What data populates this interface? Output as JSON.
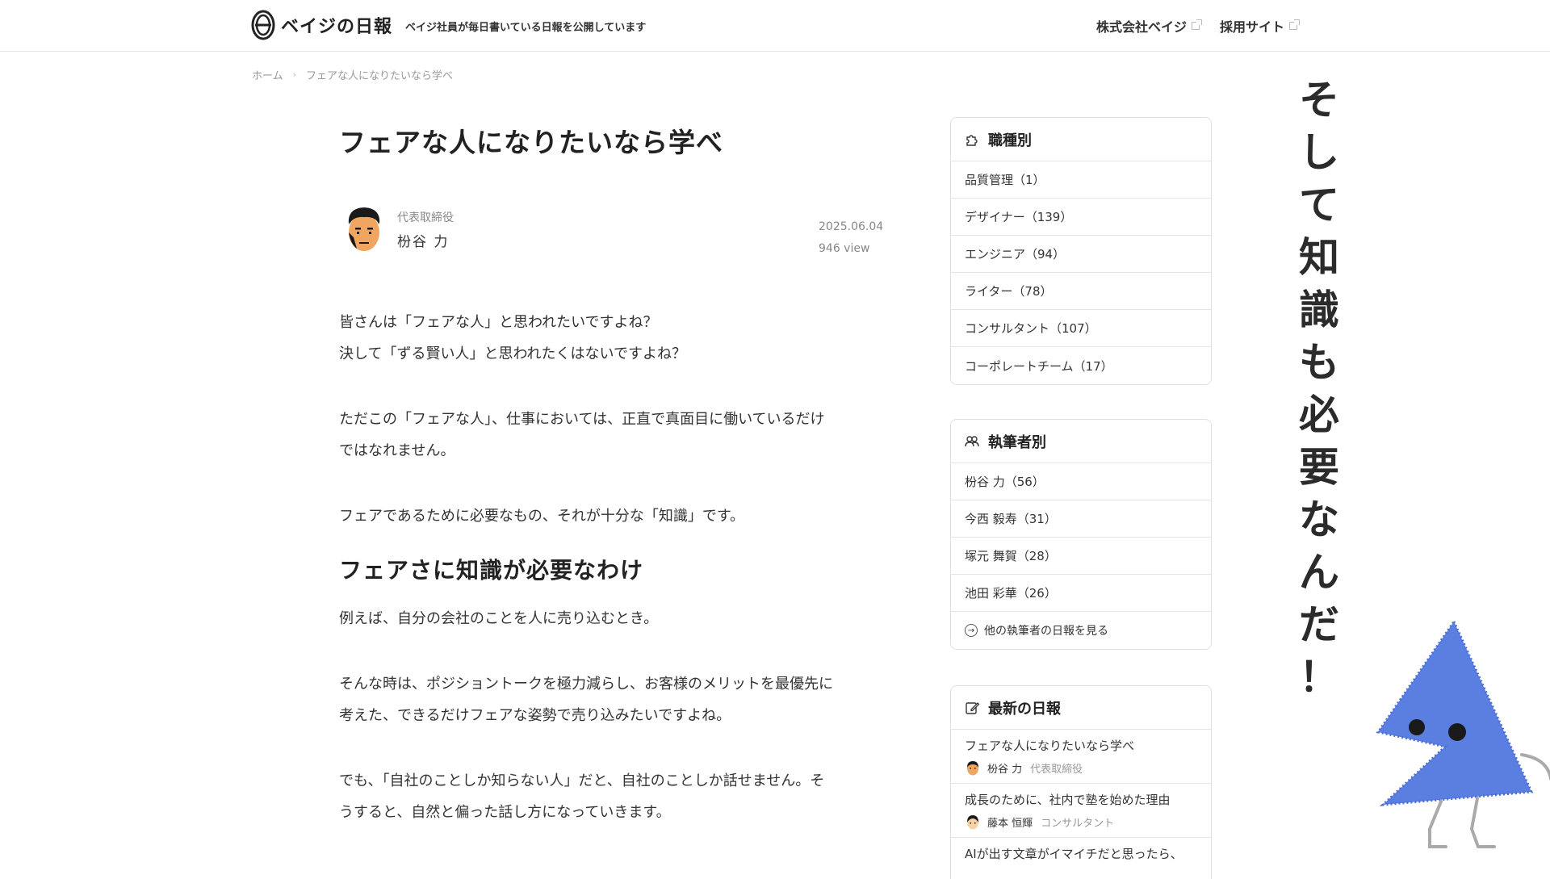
{
  "header": {
    "logo_text": "ベイジの日報",
    "tagline": "ベイジ社員が毎日書いている日報を公開しています",
    "links": [
      "株式会社ベイジ",
      "採用サイト"
    ]
  },
  "breadcrumb": {
    "home": "ホーム",
    "current": "フェアな人になりたいなら学べ"
  },
  "article": {
    "title": "フェアな人になりたいなら学べ",
    "author_role": "代表取締役",
    "author_name": "枌谷 力",
    "date": "2025.06.04",
    "views": "946 view",
    "p1_l1": "皆さんは「フェアな人」と思われたいですよね？",
    "p1_l2": "決して「ずる賢い人」と思われたくはないですよね？",
    "p2_l1": "ただこの「フェアな人」、仕事においては、正直で真面目に働いているだけ",
    "p2_l2": "ではなれません。",
    "p3": "フェアであるために必要なもの、それが十分な「知識」です。",
    "h2": "フェアさに知識が必要なわけ",
    "p4": "例えば、自分の会社のことを人に売り込むとき。",
    "p5_l1": "そんな時は、ポジショントークを極力減らし、お客様のメリットを最優先に",
    "p5_l2": "考えた、できるだけフェアな姿勢で売り込みたいですよね。",
    "p6_l1": "でも、「自社のことしか知らない人」だと、自社のことしか話せません。そ",
    "p6_l2": "うすると、自然と偏った話し方になっていきます。"
  },
  "sidebar": {
    "job": {
      "title": "職種別",
      "icon": "puzzle-icon",
      "items": [
        "品質管理（1）",
        "デザイナー（139）",
        "エンジニア（94）",
        "ライター（78）",
        "コンサルタント（107）",
        "コーポレートチーム（17）"
      ]
    },
    "writers": {
      "title": "執筆者別",
      "icon": "people-icon",
      "items": [
        "枌谷 力（56）",
        "今西 毅寿（31）",
        "塚元 舞賀（28）",
        "池田 彩華（26）"
      ],
      "more": "他の執筆者の日報を見る"
    },
    "latest": {
      "title": "最新の日報",
      "icon": "edit-icon",
      "items": [
        {
          "title": "フェアな人になりたいなら学べ",
          "name": "枌谷 力",
          "role": "代表取締役"
        },
        {
          "title": "成長のために、社内で塾を始めた理由",
          "name": "藤本 恒輝",
          "role": "コンサルタント"
        },
        {
          "title": "AIが出す文章がイマイチだと思ったら、",
          "name": "",
          "role": ""
        }
      ]
    }
  },
  "overlay": {
    "chars": [
      "そ",
      "し",
      "て",
      "知",
      "識",
      "も",
      "必",
      "要",
      "な",
      "ん",
      "だ",
      "！"
    ]
  },
  "colors": {
    "mascot": "#5b7fe0",
    "text": "#222222",
    "border": "#e0e0e0"
  }
}
